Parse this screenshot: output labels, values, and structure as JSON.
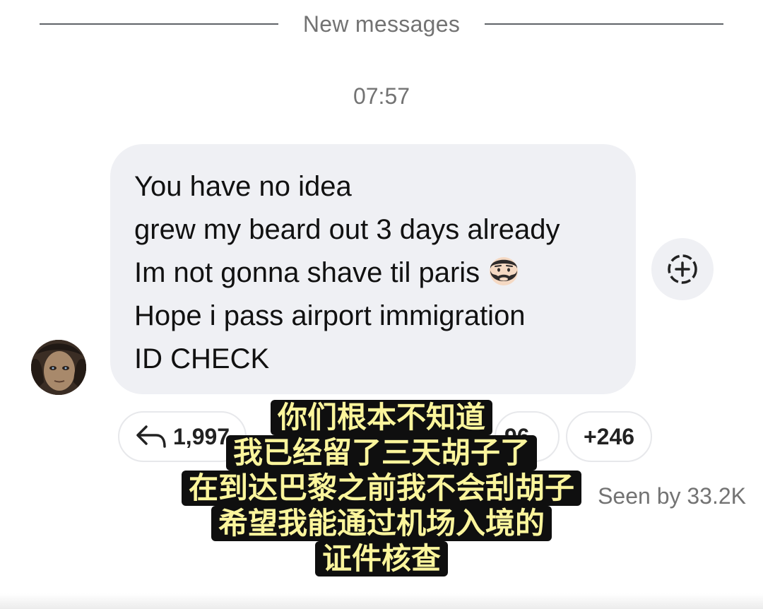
{
  "divider": {
    "label": "New messages"
  },
  "timestamp": "07:57",
  "message": {
    "lines": [
      "You have no idea",
      "grew my beard out 3 days already",
      "Im not gonna shave til paris",
      "Hope i pass airport immigration",
      "ID CHECK"
    ],
    "emoji": "bearded-man-emoji"
  },
  "reactions": {
    "reply_count": "1,997",
    "hidden_count": "96",
    "more": "+246"
  },
  "seen_by": "Seen by 33.2K",
  "subtitles": [
    "你们根本不知道",
    "我已经留了三天胡子了",
    "在到达巴黎之前我不会刮胡子",
    "希望我能通过机场入境的",
    "证件核查"
  ],
  "colors": {
    "bubble": "#eff0f4",
    "subtitle_text": "#fbf59c",
    "subtitle_bg": "#0f0f0f",
    "muted": "#737373"
  }
}
